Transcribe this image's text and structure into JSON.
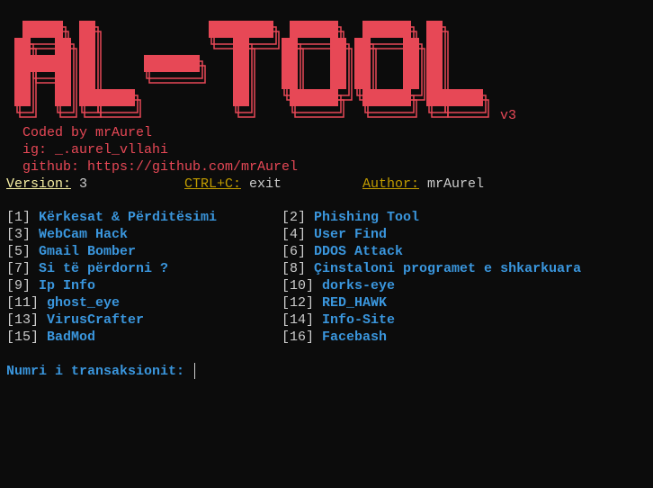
{
  "banner": {
    "logo_text": "AL-TOOL",
    "version_tag": "v3",
    "lines": [
      "Coded by mrAurel",
      "ig: _.aurel_vllahi",
      "github: https://github.com/mrAurel"
    ]
  },
  "info_bar": {
    "version_label": "Version:",
    "version_value": "3",
    "exit_label": "CTRL+C:",
    "exit_value": "exit",
    "author_label": "Author:",
    "author_value": "mrAurel"
  },
  "menu": [
    {
      "num": "[1]",
      "label": "Kërkesat & Përditësimi"
    },
    {
      "num": "[2]",
      "label": "Phishing Tool"
    },
    {
      "num": "[3]",
      "label": "WebCam Hack"
    },
    {
      "num": "[4]",
      "label": "User Find"
    },
    {
      "num": "[5]",
      "label": "Gmail Bomber"
    },
    {
      "num": "[6]",
      "label": "DDOS Attack"
    },
    {
      "num": "[7]",
      "label": "Si të përdorni ?"
    },
    {
      "num": "[8]",
      "label": "Çinstaloni programet e shkarkuara"
    },
    {
      "num": "[9]",
      "label": "Ip Info"
    },
    {
      "num": "[10]",
      "label": "dorks-eye"
    },
    {
      "num": "[11]",
      "label": "ghost_eye"
    },
    {
      "num": "[12]",
      "label": "RED_HAWK"
    },
    {
      "num": "[13]",
      "label": "VirusCrafter"
    },
    {
      "num": "[14]",
      "label": "Info-Site"
    },
    {
      "num": "[15]",
      "label": "BadMod"
    },
    {
      "num": "[16]",
      "label": "Facebash"
    }
  ],
  "prompt": {
    "label": "Numri i transaksionit:",
    "value": ""
  },
  "colors": {
    "accent_red": "#e74856",
    "menu_blue": "#3a96dd",
    "gold": "#c19c00",
    "background": "#0c0c0c"
  }
}
